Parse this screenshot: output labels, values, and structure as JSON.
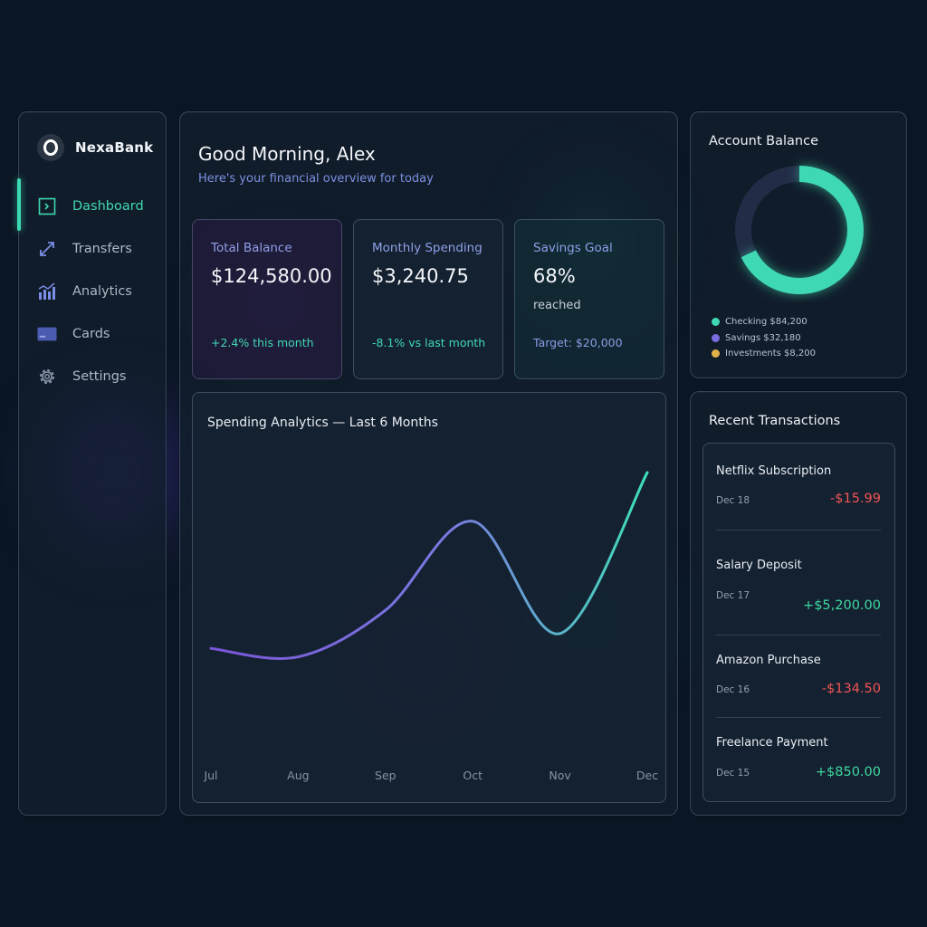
{
  "colors": {
    "background": "#0b1624",
    "accent_teal": "#3fd8b4",
    "accent_purple": "#7b6be0",
    "accent_gold": "#e0b24a",
    "negative": "#f05454",
    "positive": "#3fd8a0"
  },
  "brand": {
    "name": "NexaBank",
    "logo_icon": "bank-logo-icon"
  },
  "sidebar": {
    "items": [
      {
        "label": "Dashboard",
        "icon": "dashboard-icon",
        "active": true
      },
      {
        "label": "Transfers",
        "icon": "transfer-arrows-icon",
        "active": false
      },
      {
        "label": "Analytics",
        "icon": "analytics-chart-icon",
        "active": false
      },
      {
        "label": "Cards",
        "icon": "card-icon",
        "active": false
      },
      {
        "label": "Settings",
        "icon": "gear-icon",
        "active": false
      }
    ]
  },
  "header": {
    "greeting": "Good Morning, Alex",
    "subtitle": "Here's your financial overview for today"
  },
  "stats": [
    {
      "label": "Total Balance",
      "value": "$124,580.00",
      "footer": "+2.4% this month"
    },
    {
      "label": "Monthly Spending",
      "value": "$3,240.75",
      "footer": "-8.1% vs last month"
    },
    {
      "label": "Savings Goal",
      "value": "68%",
      "sub": "reached",
      "footer": "Target: $20,000"
    }
  ],
  "chart_data": {
    "type": "line",
    "title": "Spending Analytics — Last 6 Months",
    "categories": [
      "Jul",
      "Aug",
      "Sep",
      "Oct",
      "Nov",
      "Dec"
    ],
    "values": [
      0.17,
      0.13,
      0.35,
      0.77,
      0.24,
      1.0
    ],
    "xlabel": "",
    "ylabel": "",
    "grid": false,
    "legend": "none"
  },
  "balance": {
    "title": "Account Balance",
    "ring_fill_fraction": 0.68,
    "legend": [
      {
        "label": "Checking $84,200",
        "color": "#3fd8b4"
      },
      {
        "label": "Savings $32,180",
        "color": "#7b6be0"
      },
      {
        "label": "Investments $8,200",
        "color": "#e0b24a"
      }
    ]
  },
  "transactions": {
    "title": "Recent Transactions",
    "items": [
      {
        "name": "Netflix Subscription",
        "date": "Dec 18",
        "amount": "-$15.99",
        "type": "neg"
      },
      {
        "name": "Salary Deposit",
        "date": "Dec 17",
        "amount": "+$5,200.00",
        "type": "pos"
      },
      {
        "name": "Amazon Purchase",
        "date": "Dec 16",
        "amount": "-$134.50",
        "type": "neg"
      },
      {
        "name": "Freelance Payment",
        "date": "Dec 15",
        "amount": "+$850.00",
        "type": "pos"
      }
    ]
  }
}
